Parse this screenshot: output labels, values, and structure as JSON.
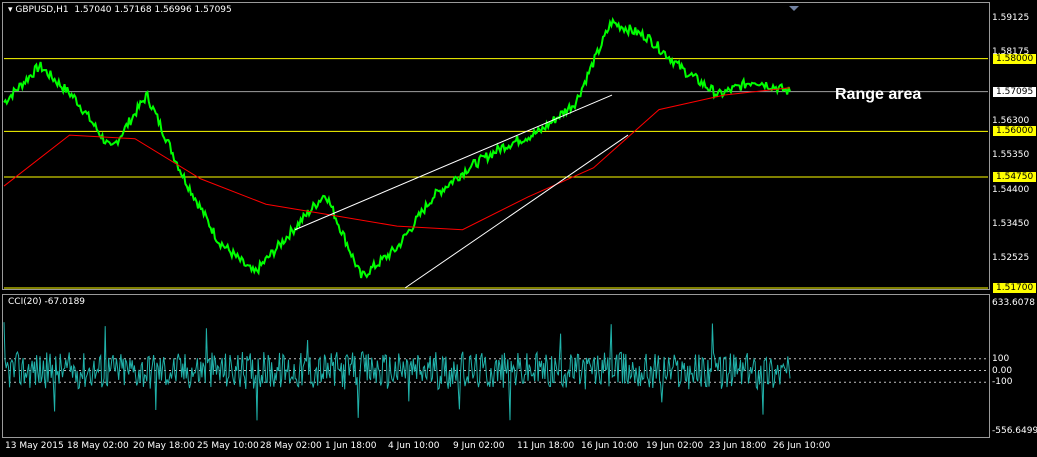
{
  "header": {
    "symbol": "GBPUSD,H1",
    "ohlc": "1.57040 1.57168 1.56996 1.57095",
    "menu_arrow_icon": "triangle-down-icon"
  },
  "annotation": {
    "text": "Range area"
  },
  "price_axis": {
    "labels": [
      "1.59125",
      "1.58175",
      "1.56300",
      "1.55350",
      "1.54400",
      "1.53450",
      "1.52525"
    ],
    "current_price": "1.57095",
    "horizontal_levels": [
      "1.58000",
      "1.56000",
      "1.54750",
      "1.51700"
    ]
  },
  "indicator": {
    "label": "CCI(20) -67.0189",
    "axis_labels": [
      "633.6078",
      "100",
      "0.00",
      "-100",
      "-556.6499"
    ]
  },
  "time_axis": {
    "labels": [
      "13 May 2015",
      "18 May 02:00",
      "20 May 18:00",
      "25 May 10:00",
      "28 May 02:00",
      "1 Jun 18:00",
      "4 Jun 10:00",
      "9 Jun 02:00",
      "11 Jun 18:00",
      "16 Jun 10:00",
      "19 Jun 02:00",
      "23 Jun 18:00",
      "26 Jun 10:00"
    ]
  },
  "colors": {
    "price": "#00ff00",
    "ma": "#ff0000",
    "levels": "#ffff00",
    "cci": "#20b2aa",
    "trendlines": "#ffffff"
  },
  "chart_data": {
    "type": "line",
    "title": "GBPUSD,H1",
    "series": [
      {
        "name": "GBPUSD,H1",
        "x": [
          "13 May 2015",
          "15 May",
          "18 May 02:00",
          "20 May 18:00",
          "22 May",
          "25 May 10:00",
          "28 May 02:00",
          "29 May",
          "1 Jun 18:00",
          "3 Jun",
          "4 Jun 10:00",
          "5 Jun",
          "9 Jun 02:00",
          "10 Jun",
          "11 Jun 18:00",
          "15 Jun",
          "16 Jun 10:00",
          "18 Jun",
          "19 Jun 02:00",
          "22 Jun",
          "23 Jun 18:00",
          "25 Jun",
          "26 Jun 10:00"
        ],
        "values": [
          1.568,
          1.578,
          1.569,
          1.555,
          1.57,
          1.548,
          1.53,
          1.521,
          1.532,
          1.543,
          1.52,
          1.528,
          1.542,
          1.55,
          1.556,
          1.56,
          1.568,
          1.59,
          1.586,
          1.577,
          1.57,
          1.574,
          1.5709
        ]
      },
      {
        "name": "MA",
        "x": [
          "13 May 2015",
          "18 May 02:00",
          "20 May 18:00",
          "25 May 10:00",
          "28 May 02:00",
          "1 Jun 18:00",
          "4 Jun 10:00",
          "9 Jun 02:00",
          "11 Jun 18:00",
          "16 Jun 10:00",
          "19 Jun 02:00",
          "23 Jun 18:00",
          "26 Jun 10:00"
        ],
        "values": [
          1.545,
          1.559,
          1.558,
          1.547,
          1.54,
          1.537,
          1.534,
          1.533,
          1.542,
          1.55,
          1.566,
          1.57,
          1.572
        ]
      }
    ],
    "ylim": [
      1.517,
      1.595
    ],
    "horizontal_lines": [
      1.58,
      1.56,
      1.5475,
      1.517
    ],
    "cci": {
      "name": "CCI(20)",
      "last": -67.0189,
      "ylim": [
        -556.6499,
        633.6078
      ],
      "levels": [
        100,
        0,
        -100
      ]
    }
  }
}
